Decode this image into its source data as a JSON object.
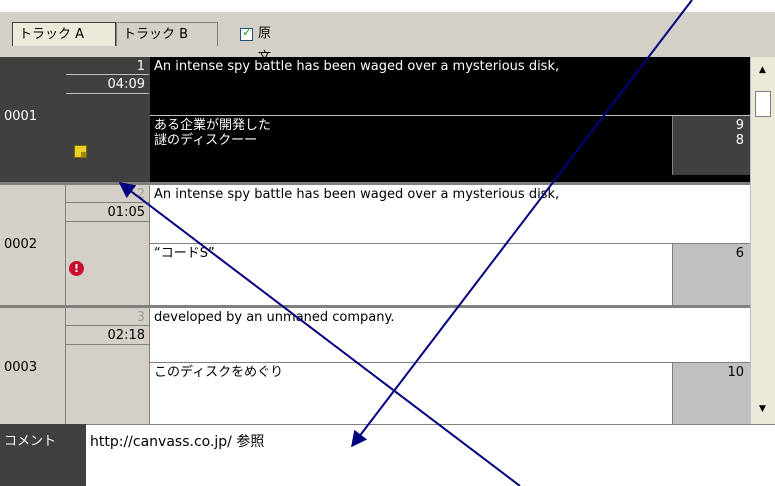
{
  "tabs": [
    {
      "label": "トラック A",
      "active": true
    },
    {
      "label": "トラック B",
      "active": false
    }
  ],
  "checkbox": {
    "label": "原文",
    "checked": true
  },
  "rows": [
    {
      "id": "0001",
      "segment": "1",
      "time": "04:09",
      "source": "An intense spy battle has been waged over a mysterious disk,",
      "target_line1": "ある企業が開発した",
      "target_line2": "謎のディスクーー",
      "count1": "9",
      "count2": "8",
      "icon": "note-icon"
    },
    {
      "id": "0002",
      "segment": "2",
      "time": "01:05",
      "source": "An intense spy battle has been waged over a mysterious disk,",
      "target_line1": "“コードS”",
      "count1": "6",
      "icon": "error-icon"
    },
    {
      "id": "0003",
      "segment": "3",
      "time": "02:18",
      "source": "developed by an unmaned company.",
      "target_line1": "このディスクをめぐり",
      "count1": "10"
    }
  ],
  "comment": {
    "label": "コメント",
    "value": "http://canvass.co.jp/ 参照"
  },
  "colors": {
    "selected_row": "#000000",
    "panel_gray": "#d4d0c8",
    "dark_gray": "#404040",
    "arrow": "#00007f"
  }
}
